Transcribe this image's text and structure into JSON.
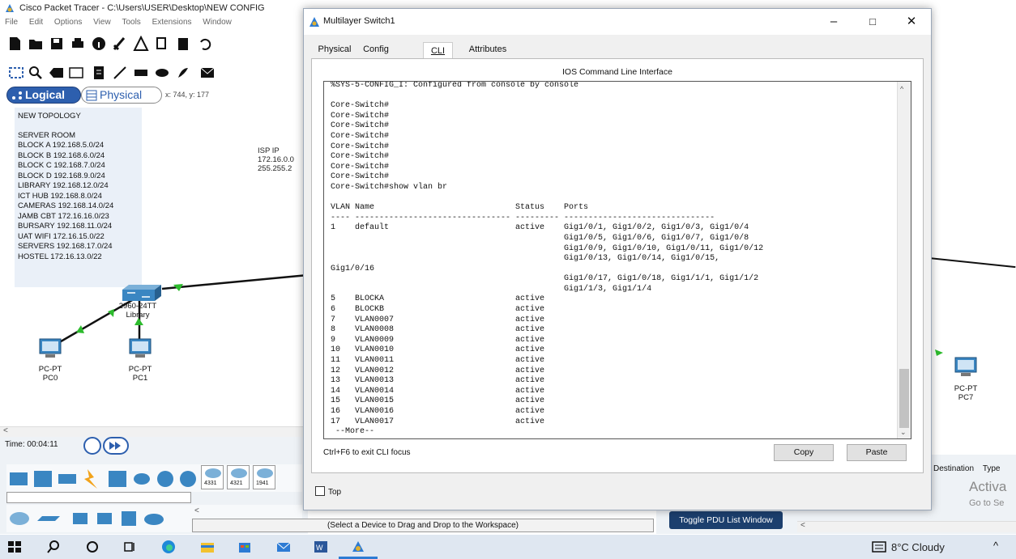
{
  "app": {
    "title": "Cisco Packet Tracer - C:\\Users\\USER\\Desktop\\NEW CONFIG",
    "menu": [
      "File",
      "Edit",
      "Options",
      "View",
      "Tools",
      "Extensions",
      "Window"
    ]
  },
  "workspace": {
    "logical_tab": "Logical",
    "physical_tab": "Physical",
    "coords": "x: 744, y: 177",
    "note": {
      "title": "NEW TOPOLOGY",
      "lines": [
        "SERVER ROOM",
        "BLOCK A   192.168.5.0/24",
        "BLOCK B   192.168.6.0/24",
        "BLOCK C   192.168.7.0/24",
        "BLOCK D    192.168.9.0/24",
        "LIBRARY   192.168.12.0/24",
        "ICT HUB   192.168.8.0/24",
        "CAMERAS 192.168.14.0/24",
        "JAMB CBT 172.16.16.0/23",
        "BURSARY 192.168.11.0/24",
        "UAT WIFI  172.16.15.0/22",
        "SERVERS  192.168.17.0/24",
        "HOSTEL    172.16.13.0/22"
      ]
    },
    "isp_note": [
      "ISP IP",
      "172.16.0.0",
      "255.255.2"
    ],
    "switch_label": [
      "2960-24TT",
      "Library"
    ],
    "pcs": [
      {
        "type": "PC-PT",
        "name": "PC0"
      },
      {
        "type": "PC-PT",
        "name": "PC1"
      },
      {
        "type": "PC-PT",
        "name": "PC7"
      }
    ],
    "time": "Time: 00:04:11",
    "router_models": [
      "4331",
      "4321",
      "1941"
    ],
    "status_text": "(Select a Device to Drag and Drop to the Workspace)",
    "toggle_pdu": "Toggle PDU List Window",
    "pdu_headers": [
      "Destination",
      "Type"
    ],
    "activate": [
      "Activa",
      "Go to Se"
    ]
  },
  "dialog": {
    "title": "Multilayer Switch1",
    "tabs": [
      "Physical",
      "Config",
      "CLI",
      "Attributes"
    ],
    "ios_title": "IOS Command Line Interface",
    "cli_lines": [
      "%SYS-5-CONFIG_I: Configured from console by console",
      "",
      "Core-Switch#",
      "Core-Switch#",
      "Core-Switch#",
      "Core-Switch#",
      "Core-Switch#",
      "Core-Switch#",
      "Core-Switch#",
      "Core-Switch#",
      "Core-Switch#show vlan br",
      "",
      "VLAN Name                             Status    Ports",
      "---- -------------------------------- --------- -------------------------------",
      "1    default                          active    Gig1/0/1, Gig1/0/2, Gig1/0/3, Gig1/0/4",
      "                                                Gig1/0/5, Gig1/0/6, Gig1/0/7, Gig1/0/8",
      "                                                Gig1/0/9, Gig1/0/10, Gig1/0/11, Gig1/0/12",
      "                                                Gig1/0/13, Gig1/0/14, Gig1/0/15,",
      "Gig1/0/16",
      "                                                Gig1/0/17, Gig1/0/18, Gig1/1/1, Gig1/1/2",
      "                                                Gig1/1/3, Gig1/1/4",
      "5    BLOCKA                           active",
      "6    BLOCKB                           active",
      "7    VLAN0007                         active",
      "8    VLAN0008                         active",
      "9    VLAN0009                         active",
      "10   VLAN0010                         active",
      "11   VLAN0011                         active",
      "12   VLAN0012                         active",
      "13   VLAN0013                         active",
      "14   VLAN0014                         active",
      "15   VLAN0015                         active",
      "16   VLAN0016                         active",
      "17   VLAN0017                         active",
      " --More--"
    ],
    "focus_hint": "Ctrl+F6 to exit CLI focus",
    "copy_label": "Copy",
    "paste_label": "Paste",
    "top_label": "Top"
  },
  "taskbar": {
    "weather": "8°C  Cloudy"
  }
}
